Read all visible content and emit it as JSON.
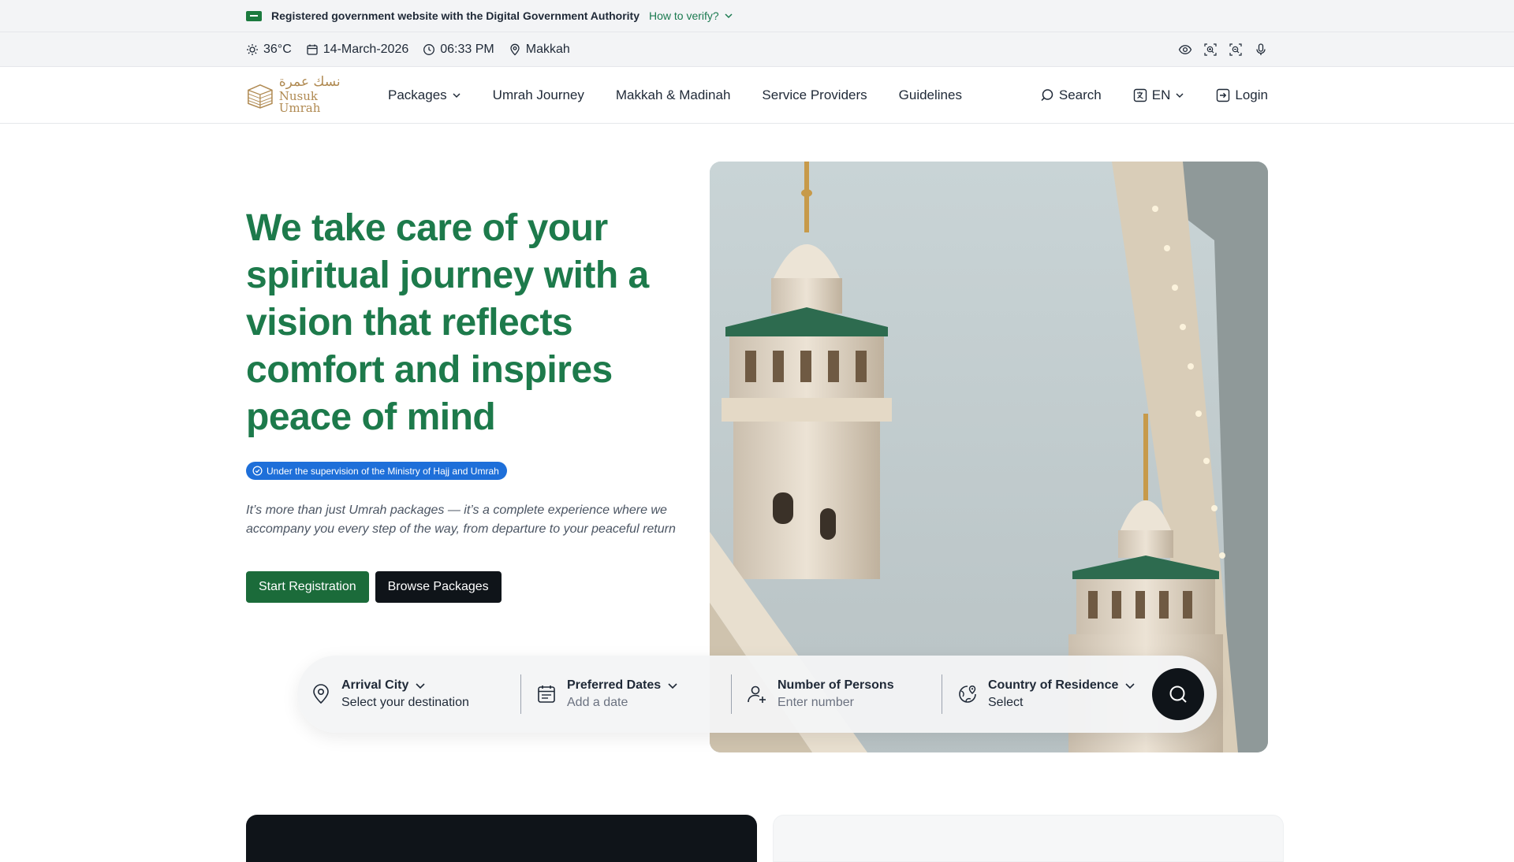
{
  "gov_banner": {
    "text": "Registered government website with the Digital Government Authority",
    "verify_label": "How to verify?"
  },
  "info_bar": {
    "temperature": "36°C",
    "date": "14-March-2026",
    "time": "06:33 PM",
    "location": "Makkah",
    "tools": [
      "eye-icon",
      "zoom-in-icon",
      "zoom-out-icon",
      "microphone-icon"
    ]
  },
  "header": {
    "logo_ar": "نسك عمرة",
    "logo_en": "Nusuk Umrah",
    "nav": [
      {
        "label": "Packages",
        "dropdown": true
      },
      {
        "label": "Umrah Journey"
      },
      {
        "label": "Makkah & Madinah"
      },
      {
        "label": "Service Providers"
      },
      {
        "label": "Guidelines"
      }
    ],
    "search_label": "Search",
    "language_label": "EN",
    "login_label": "Login"
  },
  "hero": {
    "title": "We take care of your spiritual journey with a vision that reflects comfort and inspires peace of mind",
    "badge": "Under the supervision of the Ministry of Hajj and Umrah",
    "description": "It’s more than just Umrah packages — it’s a complete experience where we accompany you every step of the way, from departure to your peaceful return",
    "primary_button": "Start Registration",
    "secondary_button": "Browse Packages"
  },
  "search": {
    "fields": [
      {
        "label": "Arrival City",
        "value": "Select your destination",
        "icon": "map-pin-icon"
      },
      {
        "label": "Preferred Dates",
        "value": "Add a date",
        "icon": "calendar-icon"
      },
      {
        "label": "Number of Persons",
        "value": "Enter number",
        "icon": "user-add-icon"
      },
      {
        "label": "Country of Residence",
        "value": "Select",
        "icon": "globe-pin-icon"
      }
    ]
  },
  "colors": {
    "primary_green": "#1d7a4b",
    "button_green": "#1b6b3a",
    "badge_blue": "#1e6fd9",
    "dark": "#0f1419",
    "logo_gold": "#b08a52"
  }
}
